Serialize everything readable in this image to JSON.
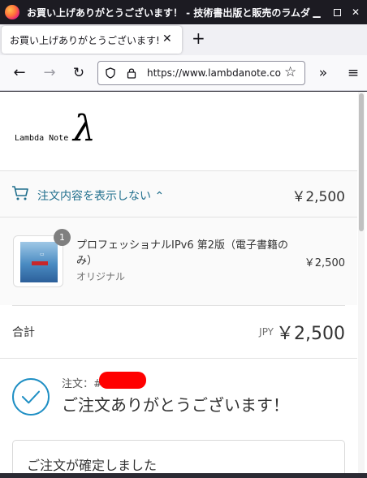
{
  "window": {
    "title": "お買い上げありがとうございます！ - 技術書出版と販売のラムダノート"
  },
  "tab": {
    "title": "お買い上げありがとうございます! - ラムダノート"
  },
  "navbar": {
    "url": "https://www.lambdanote.com/"
  },
  "logo": {
    "text": "Lambda Note",
    "symbol": "λ"
  },
  "summary": {
    "toggle_label": "注文内容を表示しない",
    "total": "￥2,500"
  },
  "line_item": {
    "quantity": "1",
    "name": "プロフェッショナルIPv6 第2版（電子書籍のみ）",
    "variant": "オリジナル",
    "price": "￥2,500"
  },
  "totals": {
    "label": "合計",
    "currency": "JPY",
    "value": "￥2,500"
  },
  "confirmation": {
    "order_label": "注文：#",
    "thanks": "ご注文ありがとうございます！",
    "card_title": "ご注文が確定しました"
  },
  "colors": {
    "accent": "#1f8fc4",
    "link": "#1f6e8c",
    "redaction": "#ff0000"
  }
}
